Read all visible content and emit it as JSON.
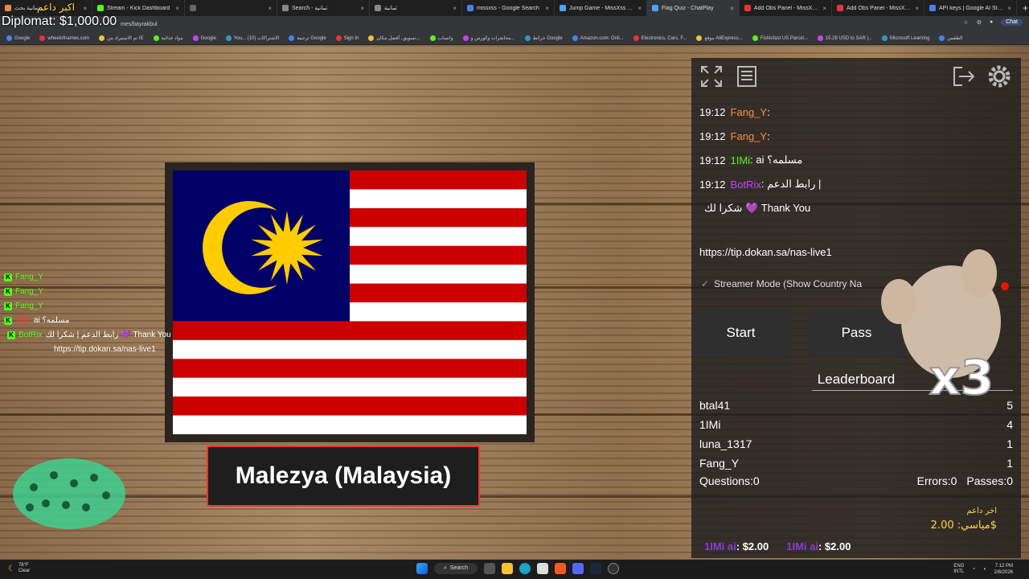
{
  "browser": {
    "tabs": [
      {
        "title": "تمانية بحث",
        "color": "#e84",
        "active": false
      },
      {
        "title": "Stream - Kick Dashboard",
        "color": "#53fc18",
        "active": false
      },
      {
        "title": "",
        "color": "#666",
        "active": false
      },
      {
        "title": "Search - ثمانية",
        "color": "#888",
        "active": false
      },
      {
        "title": "ثمانية",
        "color": "#888",
        "active": false
      },
      {
        "title": "missxss - Google Search",
        "color": "#4285f4",
        "active": false
      },
      {
        "title": "Jump Game - MissXss AI Bot Sy",
        "color": "#4aa3ff",
        "active": false
      },
      {
        "title": "Flag Quiz - ChatPlay",
        "color": "#4aa3ff",
        "active": true
      },
      {
        "title": "Add Obs Panel - MissXss (English",
        "color": "#e33",
        "active": false
      },
      {
        "title": "Add Obs Panel - MissXss (English",
        "color": "#e33",
        "active": false
      },
      {
        "title": "API keys | Google AI Studio",
        "color": "#4285f4",
        "active": false
      }
    ],
    "new_tab": "+",
    "url": "mes/bayrakbul",
    "chat_label": "Chat",
    "bookmarks": [
      "Google",
      "wheelofnames.com",
      "تم الاستيراد من IE",
      "مواد غذائية",
      "Google",
      "You... (10) الاشتراكات",
      "ترجمة Google",
      "Sign In",
      "تسويق، أفضل مكان...",
      "واتساب",
      "محاضرات وكورس و...",
      "خرائط Google",
      "Amazon.com: Onli...",
      "Electronics, Cars, F...",
      "موقع AliExpress...",
      "Fishisfast US Parcel...",
      "15.28 USD to SAR |...",
      "Microsoft Learning",
      "الطقس"
    ]
  },
  "overlay": {
    "diplomat": "Diplomat: $1,000.00",
    "diplomat_ar": "اكبر داعم"
  },
  "quiz": {
    "answer": "Malezya (Malaysia)",
    "flag_country": "Malaysia",
    "colors": {
      "red": "#cc0001",
      "white": "#ffffff",
      "blue": "#010066",
      "yellow": "#ffcc00"
    }
  },
  "mini_chat": [
    {
      "user": "Fang_Y",
      "text": "",
      "color": "#53fc18"
    },
    {
      "user": "Fang_Y",
      "text": "",
      "color": "#53fc18"
    },
    {
      "user": "Fang_Y",
      "text": "",
      "color": "#53fc18"
    },
    {
      "user": "1IMi",
      "text": "ai مسلمه؟",
      "color": "#ff3b3b"
    },
    {
      "user": "BotRix",
      "text": "رابط الدعم | شكرا لك 💜 Thank You",
      "color": "#53fc18"
    }
  ],
  "mini_chat_link": "https://tip.dokan.sa/nas-live1",
  "panel": {
    "chat": [
      {
        "time": "19:12",
        "user": "Fang_Y",
        "user_color": "#ff8a3d",
        "text": ":"
      },
      {
        "time": "19:12",
        "user": "Fang_Y",
        "user_color": "#ff8a3d",
        "text": ":"
      },
      {
        "time": "19:12",
        "user": "1IMi",
        "user_color": "#53fc18",
        "text": ": ai مسلمه؟"
      },
      {
        "time": "19:12",
        "user": "BotRix",
        "user_color": "#c642ff",
        "text": ": رابط الدعم |"
      },
      {
        "time": "",
        "user": "",
        "user_color": "#fff",
        "text": "شكرا لك 💜 Thank You"
      }
    ],
    "link": "https://tip.dokan.sa/nas-live1",
    "streamer_mode": "Streamer Mode (Show Country Na",
    "start_label": "Start",
    "pass_label": "Pass",
    "leaderboard_title": "Leaderboard",
    "leaderboard": [
      {
        "name": "btal41",
        "score": "5"
      },
      {
        "name": "1IMi",
        "score": "4"
      },
      {
        "name": "luna_1317",
        "score": "1"
      },
      {
        "name": "Fang_Y",
        "score": "1"
      }
    ],
    "questions": "Questions:0",
    "errors": "Errors:0",
    "passes": "Passes:0",
    "donate_label": "اخر داعم",
    "donate_amount": "مياسي: 2.00$"
  },
  "tips": [
    {
      "name": "1IMi ai",
      "amount": ": $2.00"
    },
    {
      "name": "1IMi ai",
      "amount": ": $2.00"
    }
  ],
  "cat_multiplier": "x3",
  "taskbar": {
    "weather_temp": "78°F",
    "weather_text": "Clear",
    "search_label": "Search",
    "lang": "ENG",
    "lang2": "INTL",
    "time": "7:12 PM",
    "date": "2/8/2026"
  }
}
